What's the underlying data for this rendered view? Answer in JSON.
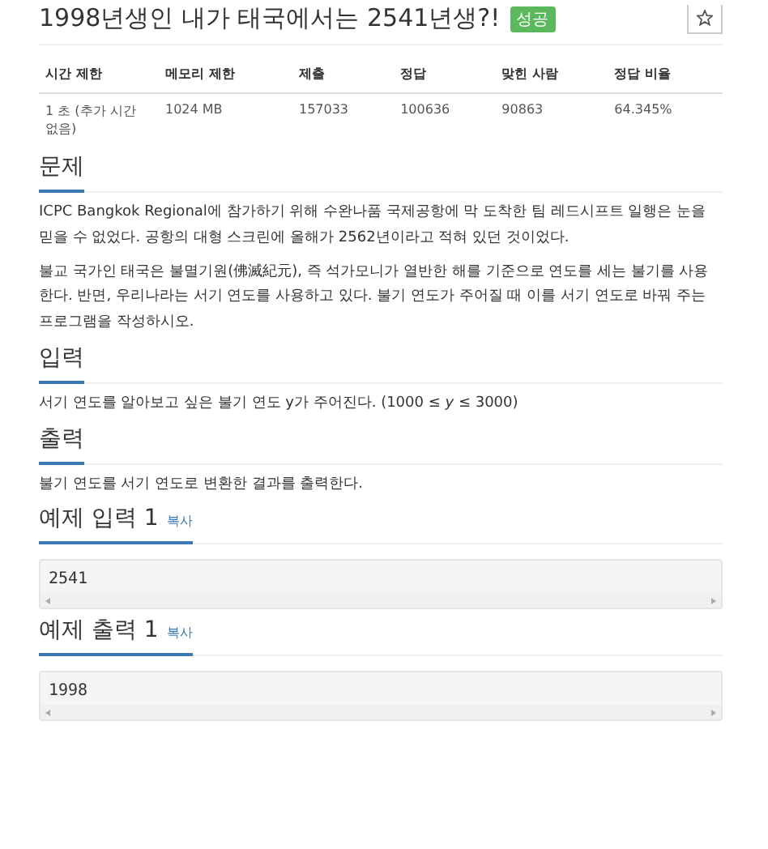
{
  "title": "1998년생인 내가 태국에서는 2541년생?!",
  "badge": "성공",
  "info_table": {
    "columns": [
      "시간 제한",
      "메모리 제한",
      "제출",
      "정답",
      "맞힌 사람",
      "정답 비율"
    ],
    "rows": [
      [
        "1 초 (추가 시간 없음)",
        "1024 MB",
        "157033",
        "100636",
        "90863",
        "64.345%"
      ]
    ]
  },
  "sections": [
    {
      "kind": "text",
      "heading": "문제",
      "paragraphs": [
        "ICPC Bangkok Regional에 참가하기 위해 수완나품 국제공항에 막 도착한 팀 레드시프트 일행은 눈을 믿을 수 없었다. 공항의 대형 스크린에 올해가 2562년이라고 적혀 있던 것이었다.",
        "불교 국가인 태국은 불멸기원(佛滅紀元), 즉 석가모니가 열반한 해를 기준으로 연도를 세는 불기를 사용한다. 반면, 우리나라는 서기 연도를 사용하고 있다. 불기 연도가 주어질 때 이를 서기 연도로 바꿔 주는 프로그램을 작성하시오."
      ]
    },
    {
      "kind": "text",
      "heading": "입력",
      "paragraphs": [
        "서기 연도를 알아보고 싶은 불기 연도 y가 주어진다. (1000 ≤ *y* ≤ 3000)"
      ]
    },
    {
      "kind": "text",
      "heading": "출력",
      "paragraphs": [
        "불기 연도를 서기 연도로 변환한 결과를 출력한다."
      ]
    },
    {
      "kind": "sample",
      "heading": "예제 입력 1",
      "copy": "복사",
      "code": "2541"
    },
    {
      "kind": "sample",
      "heading": "예제 출력 1",
      "copy": "복사",
      "code": "1998"
    }
  ]
}
